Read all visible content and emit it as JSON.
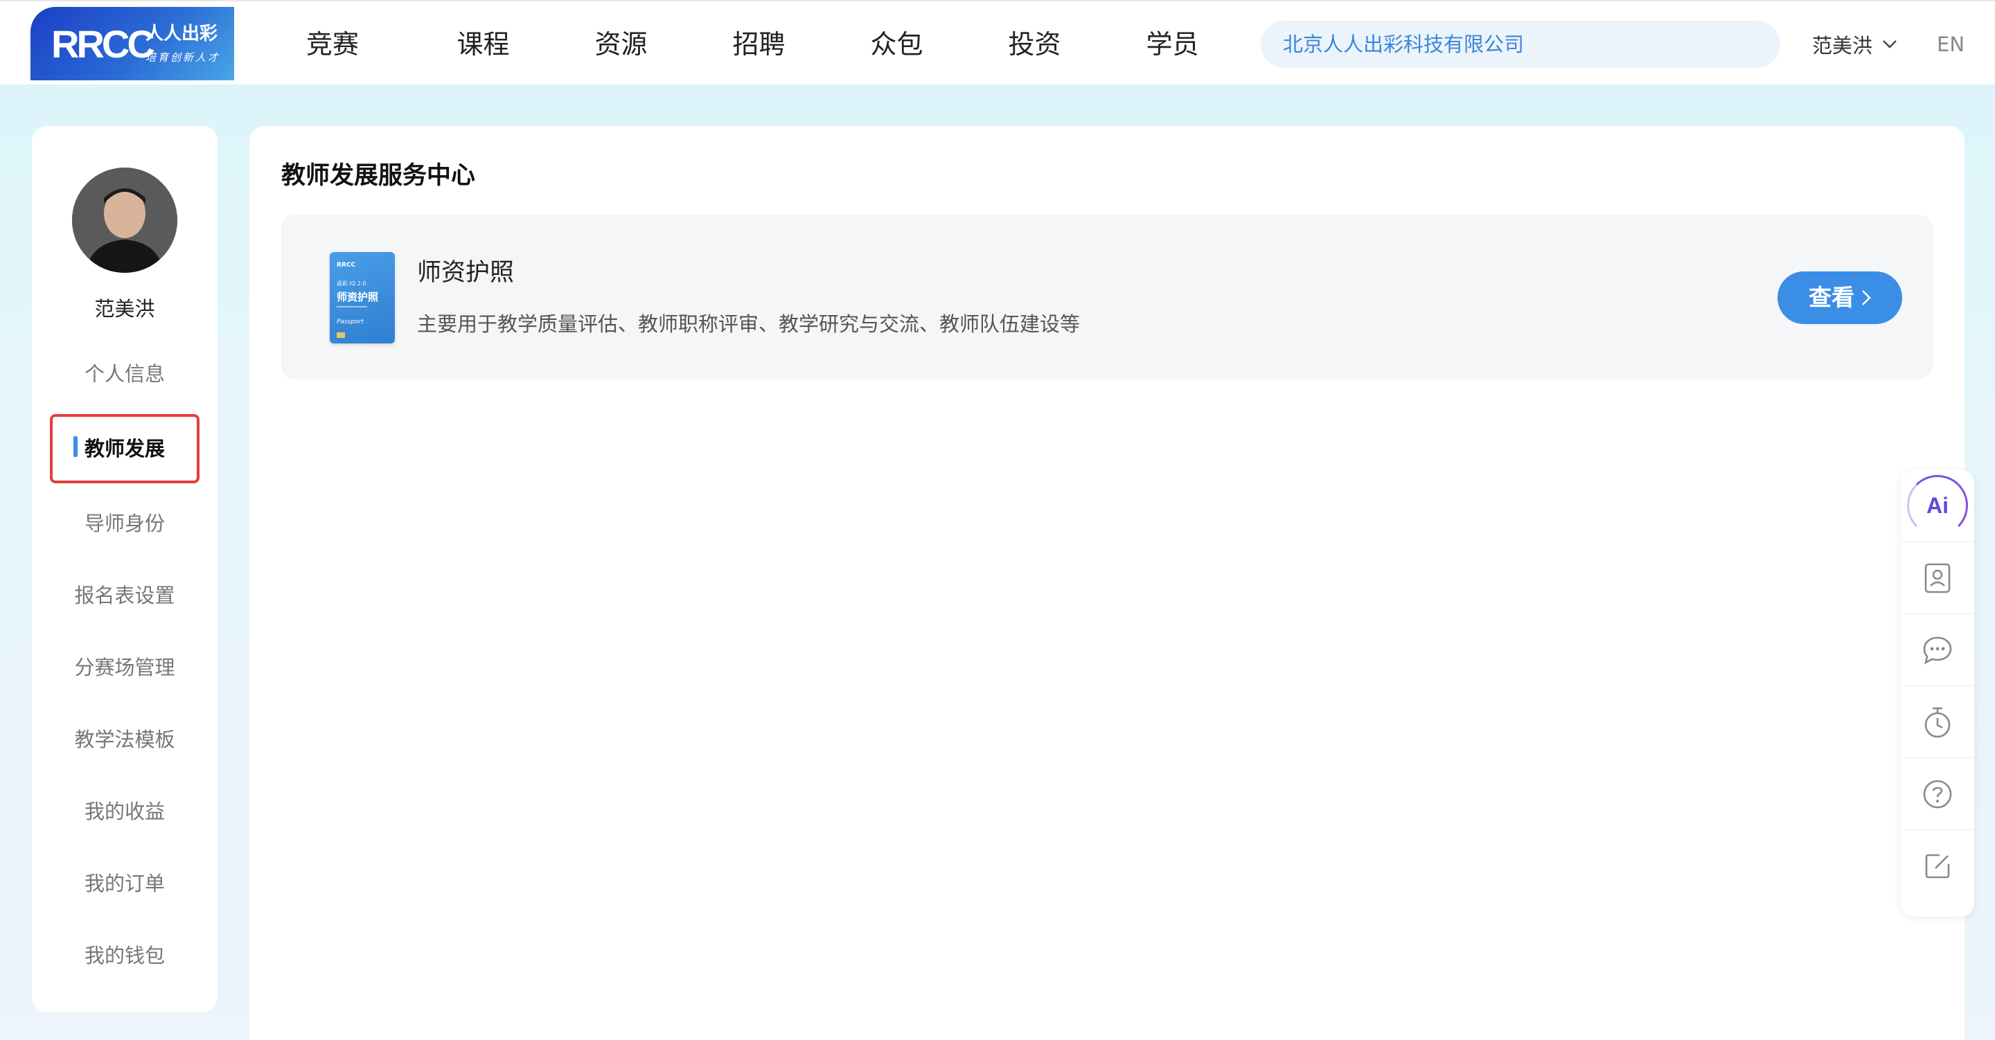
{
  "header": {
    "logo_mark": "RRCC",
    "logo_cn": "人人出彩",
    "logo_sub": "培育创新人才",
    "nav": [
      "竞赛",
      "课程",
      "资源",
      "招聘",
      "众包",
      "投资",
      "学员"
    ],
    "company": "北京人人出彩科技有限公司",
    "user_name": "范美洪",
    "lang": "EN"
  },
  "sidebar": {
    "name": "范美洪",
    "items": [
      {
        "label": "个人信息"
      },
      {
        "label": "教师发展"
      },
      {
        "label": "导师身份"
      },
      {
        "label": "报名表设置"
      },
      {
        "label": "分赛场管理"
      },
      {
        "label": "教学法模板"
      },
      {
        "label": "我的收益"
      },
      {
        "label": "我的订单"
      },
      {
        "label": "我的钱包"
      }
    ],
    "active_index": 1
  },
  "main": {
    "title": "教师发展服务中心",
    "card": {
      "title": "师资护照",
      "description": "主要用于教学质量评估、教师职称评审、教学研究与交流、教师队伍建设等",
      "button": "查看",
      "cover": {
        "brand": "RRCC",
        "small": "返彩 IQ 2.0",
        "title": "师资护照",
        "foot": "Passport"
      }
    }
  },
  "float_bar": {
    "ai_label": "Ai",
    "icons": [
      "ai-icon",
      "contact-card-icon",
      "chat-icon",
      "timer-icon",
      "help-icon",
      "edit-icon"
    ]
  },
  "colors": {
    "accent": "#3a8ee6",
    "active_border": "#e0403b",
    "company_text": "#3b86d8"
  }
}
